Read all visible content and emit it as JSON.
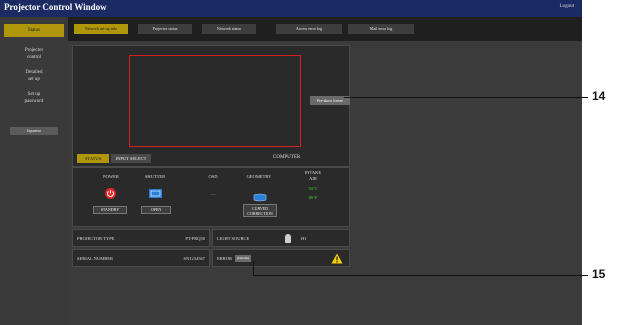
{
  "app": {
    "title": "Projector Control Window",
    "logout": "Logout"
  },
  "sidebar": {
    "status": "Status",
    "items": [
      "Projector\ncontrol",
      "Detailed\nset up",
      "Set up\npassword"
    ],
    "button": "Japanese"
  },
  "tabs": [
    {
      "label": "Network set-up info"
    },
    {
      "label": "Projector status"
    },
    {
      "label": "Network status"
    },
    {
      "label": "Access error log"
    },
    {
      "label": "Mail error log"
    }
  ],
  "preview": {
    "freeze_button": "Pre-show freeze"
  },
  "status_bar": {
    "status_tab": "STATUS",
    "input_select_tab": "INPUT SELECT",
    "input_value": "COMPUTER"
  },
  "state": {
    "power": {
      "label": "POWER",
      "button": "STANDBY"
    },
    "shutter": {
      "label": "SHUTTER",
      "button": "OPEN"
    },
    "osd": {
      "label": "OSD",
      "value": "----"
    },
    "geometry": {
      "label": "GEOMETRY",
      "button": "CURVED\nCORRECTION"
    },
    "intake": {
      "label": "INTAKE\nAIR",
      "temp1": "30°C",
      "temp2": "86°F"
    }
  },
  "info": {
    "projector_type_label": "PROJECTOR TYPE",
    "projector_type_value": "PT-FRQ50",
    "serial_label": "SERIAL NUMBER",
    "serial_value": "SN1234567",
    "light_source_label": "LIGHT SOURCE",
    "light_source_value": "H1",
    "error_label": "ERROR",
    "error_button": "(Details)"
  },
  "callouts": {
    "c14": "14",
    "c15": "15"
  },
  "colors": {
    "accent": "#b0960a",
    "titlebar": "#1c2a63",
    "power_red": "#e02424",
    "shutter_blue": "#2b7fd6",
    "warning_yellow": "#f5d000"
  }
}
